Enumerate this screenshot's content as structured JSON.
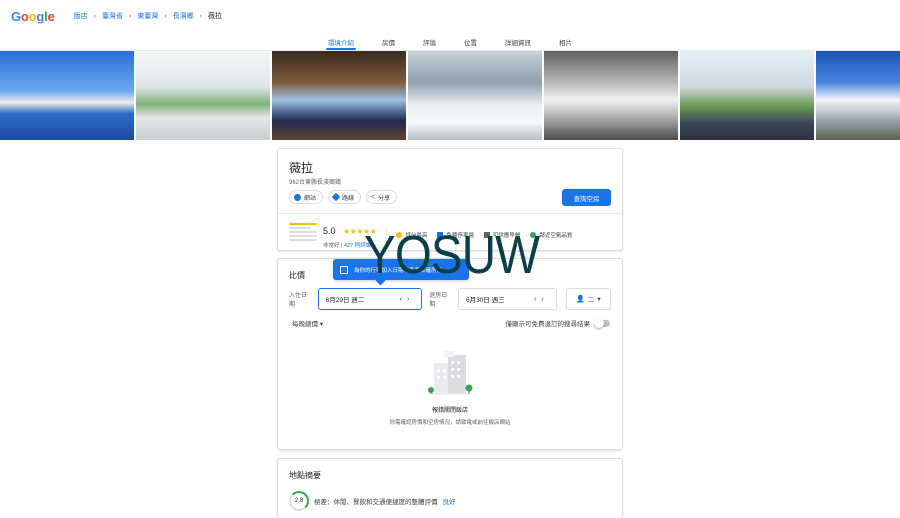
{
  "header": {
    "logo": "Google",
    "logo_colors": [
      "#4285f4",
      "#ea4335",
      "#fbbc05",
      "#4285f4",
      "#34a853",
      "#ea4335"
    ],
    "breadcrumb": [
      "飯店",
      "臺灣省",
      "東臺灣",
      "長濱鄉",
      "薇拉"
    ]
  },
  "tabs": [
    "環境介紹",
    "房價",
    "評論",
    "位置",
    "詳細資訊",
    "相片"
  ],
  "active_tab": "環境介紹",
  "hotel": {
    "name": "薇拉",
    "address": "962台東縣長濱鄉鐵",
    "actions": {
      "website": "網站",
      "directions": "路線",
      "share": "分享"
    },
    "check_availability": "查詢空房",
    "rating": "5.0",
    "stars": "★★★★★",
    "rating_label": "非常好",
    "review_count": "427 則評論",
    "amenities": [
      "評分最高",
      "免費停車場",
      "可供應早餐",
      "鄰近空氣品質"
    ]
  },
  "pricing": {
    "title": "比價",
    "checkin_label": "入住日期",
    "checkin_value": "6月29日 週二",
    "checkout_label": "退房日期",
    "checkout_value": "6月30日 週三",
    "guests": "二",
    "tooltip": "為你的行程加入日期以查看準確房價",
    "per_night": "每晚總價",
    "free_cancel": "僅顯示可免費退訂的搜尋結果",
    "empty_title": "報錯關閉飯店",
    "empty_sub": "你需確認房價和空房情況，請致電或前往飯店網站"
  },
  "location": {
    "title": "地點摘要",
    "score": "2.8",
    "text": "極差：休閒、餐飲和交通便捷度的整體評價",
    "link": "良好"
  },
  "watermark": "YOSUW"
}
